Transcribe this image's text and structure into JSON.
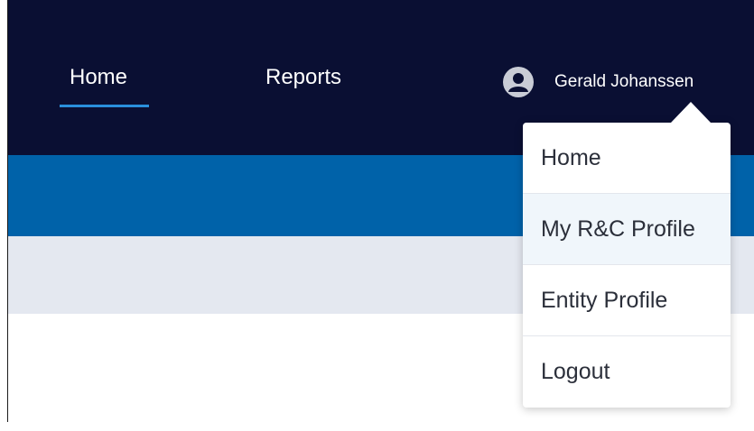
{
  "nav": {
    "tabs": [
      {
        "label": "Home",
        "active": true
      },
      {
        "label": "Reports",
        "active": false
      }
    ],
    "active_indicator_color": "#2a8fdc",
    "background_color": "#0a0f33"
  },
  "user": {
    "name": "Gerald Johanssen",
    "avatar_icon": "user-avatar-icon"
  },
  "bands": {
    "primary_color": "#0062a9",
    "secondary_color": "#e4e8f0"
  },
  "user_dropdown": {
    "open": true,
    "hovered_index": 1,
    "items": [
      {
        "label": "Home"
      },
      {
        "label": "My R&C Profile"
      },
      {
        "label": "Entity Profile"
      },
      {
        "label": "Logout"
      }
    ]
  }
}
